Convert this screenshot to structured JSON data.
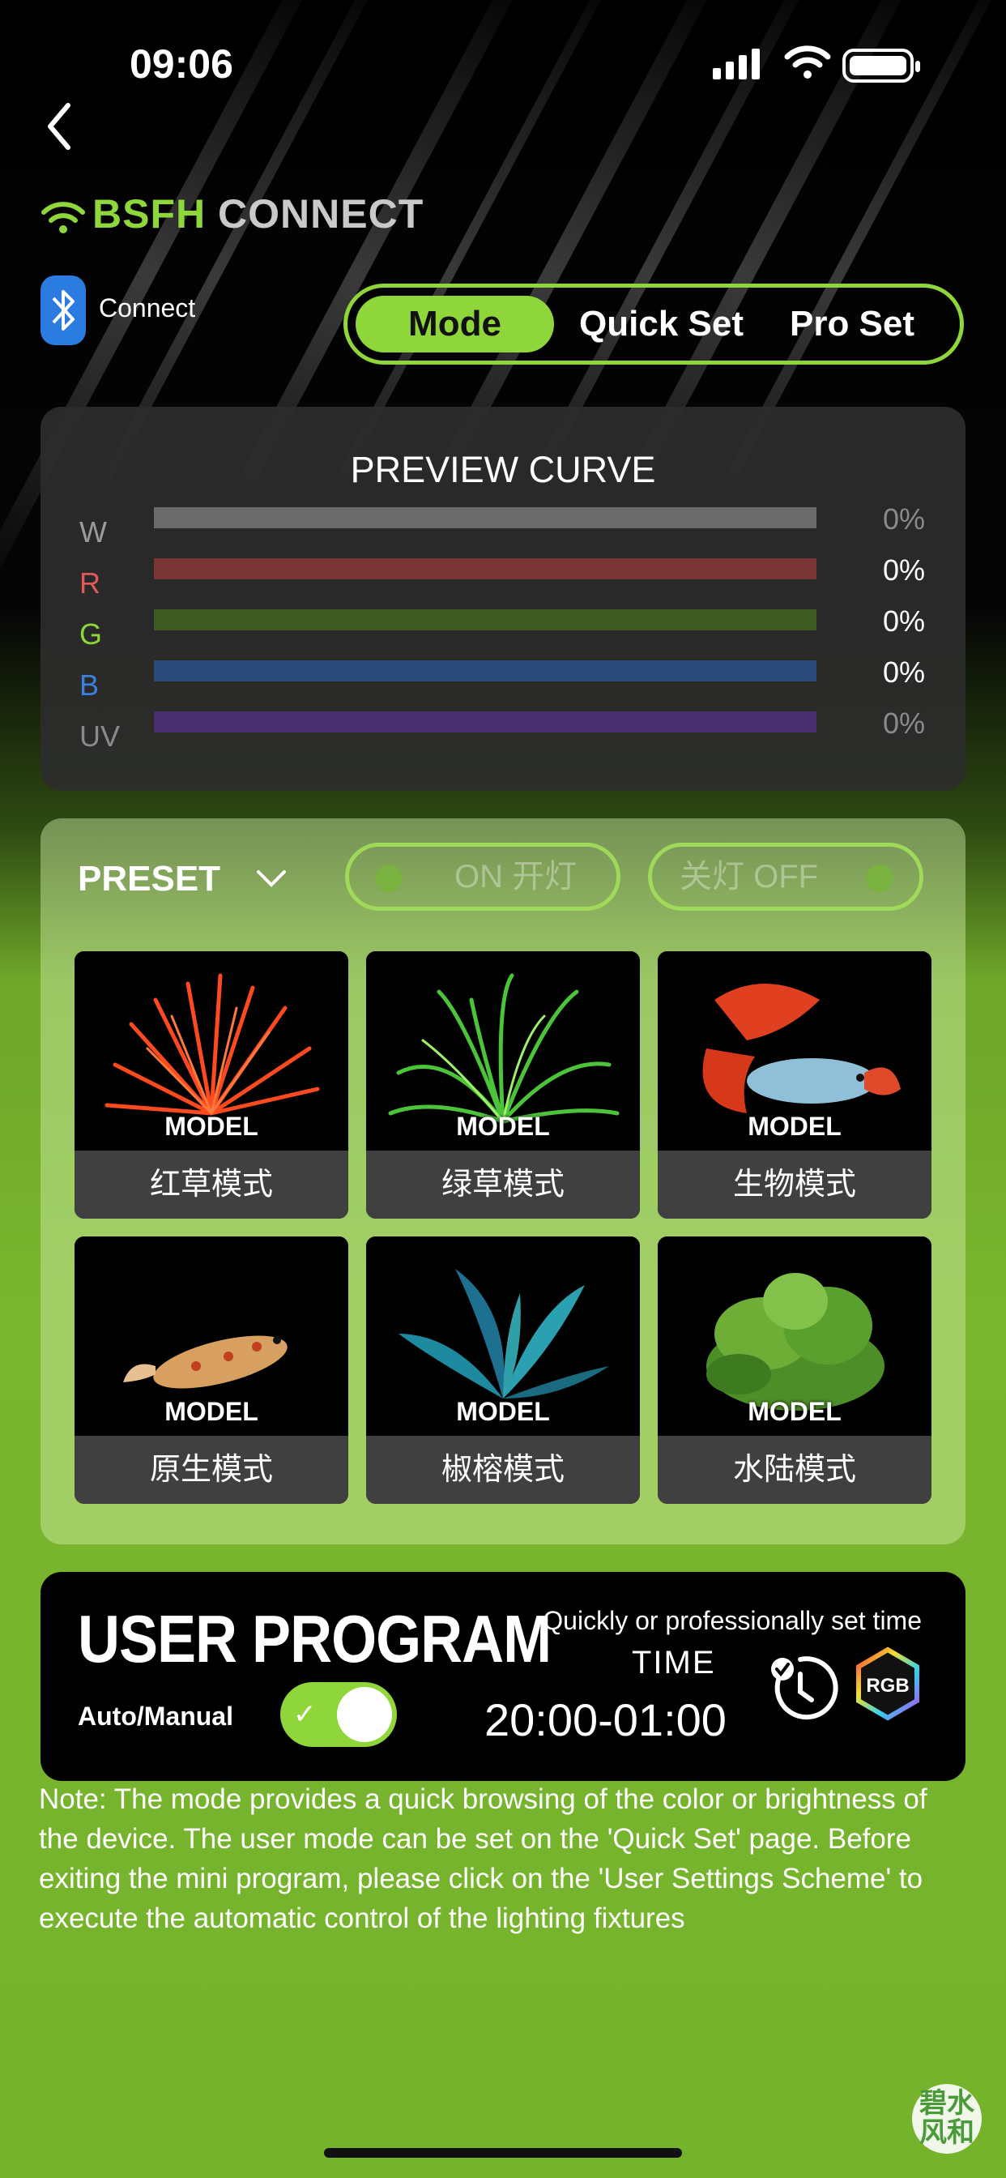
{
  "status_bar": {
    "time": "09:06"
  },
  "brand": {
    "part1": "BSFH",
    "part2": "CONNECT"
  },
  "bluetooth": {
    "label": "Connect"
  },
  "tabs": [
    {
      "label": "Mode",
      "active": true
    },
    {
      "label": "Quick Set",
      "active": false
    },
    {
      "label": "Pro Set",
      "active": false
    }
  ],
  "preview": {
    "title": "PREVIEW CURVE",
    "channels": [
      {
        "label": "W",
        "value": "0%",
        "label_color": "#9a9a9a",
        "track_color": "#6b6b6b",
        "value_color": "#8a8a8a"
      },
      {
        "label": "R",
        "value": "0%",
        "label_color": "#e05a5a",
        "track_color": "#7a3535",
        "value_color": "#ffffff"
      },
      {
        "label": "G",
        "value": "0%",
        "label_color": "#8ed63a",
        "track_color": "#3f5a22",
        "value_color": "#ffffff"
      },
      {
        "label": "B",
        "value": "0%",
        "label_color": "#3d7fe0",
        "track_color": "#2a4a7a",
        "value_color": "#ffffff"
      },
      {
        "label": "UV",
        "value": "0%",
        "label_color": "#8a8a8a",
        "track_color": "#4a2f6e",
        "value_color": "#8a8a8a"
      }
    ]
  },
  "preset": {
    "title": "PRESET",
    "on_label": "ON 开灯",
    "off_label": "关灯 OFF",
    "model_tag": "MODEL",
    "cards": [
      {
        "caption": "红草模式"
      },
      {
        "caption": "绿草模式"
      },
      {
        "caption": "生物模式"
      },
      {
        "caption": "原生模式"
      },
      {
        "caption": "椒榕模式"
      },
      {
        "caption": "水陆模式"
      }
    ]
  },
  "user_program": {
    "title": "USER PROGRAM",
    "auto_label": "Auto/Manual",
    "toggle_on": true,
    "subtitle": "Quickly or professionally set time",
    "time_label": "TIME",
    "time_range": "20:00-01:00",
    "rgb_label": "RGB"
  },
  "note": "Note: The mode provides a quick browsing of the color or brightness of the device. The user mode can be set on the 'Quick Set' page. Before exiting the mini program, please click on the 'User Settings Scheme' to execute the automatic control of the lighting fixtures",
  "watermark": {
    "line1": "碧水",
    "line2": "风和"
  },
  "colors": {
    "accent": "#8ed63a",
    "bluetooth": "#2a7ce0"
  }
}
